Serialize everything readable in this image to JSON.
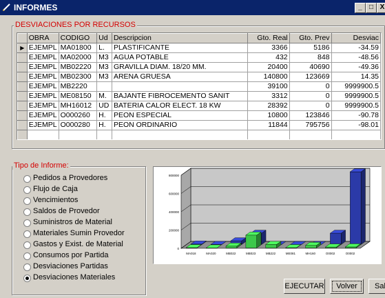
{
  "window": {
    "title": "INFORMES",
    "controls": [
      "_",
      "□",
      "X"
    ]
  },
  "grid_section": {
    "legend": "DESVIACIONES POR RECURSOS",
    "columns": [
      "OBRA",
      "CODIGO",
      "Ud",
      "Descripcion",
      "Gto. Real",
      "Gto. Prev",
      "Desviac"
    ],
    "rows": [
      [
        "EJEMPL",
        "MA01800",
        "L.",
        "PLASTIFICANTE",
        "3366",
        "5186",
        "-34.59"
      ],
      [
        "EJEMPL",
        "MA02000",
        "M3",
        "AGUA POTABLE",
        "432",
        "848",
        "-48.56"
      ],
      [
        "EJEMPL",
        "MB02220",
        "M3",
        "GRAVILLA DIAM. 18/20 MM.",
        "20400",
        "40690",
        "-49.36"
      ],
      [
        "EJEMPL",
        "MB02300",
        "M3",
        "ARENA GRUESA",
        "140800",
        "123669",
        "14.35"
      ],
      [
        "EJEMPL",
        "MB2220",
        "",
        "",
        "39100",
        "0",
        "9999900.5"
      ],
      [
        "EJEMPL",
        "ME08150",
        "M.",
        "BAJANTE FIBROCEMENTO SANIT",
        "3312",
        "0",
        "9999900.5"
      ],
      [
        "EJEMPL",
        "MH16012",
        "UD",
        "BATERIA CALOR ELECT. 18 KW",
        "28392",
        "0",
        "9999900.5"
      ],
      [
        "EJEMPL",
        "O000260",
        "H.",
        "PEON ESPECIAL",
        "10800",
        "123846",
        "-90.78"
      ],
      [
        "EJEMPL",
        "O000280",
        "H.",
        "PEON ORDINARIO",
        "11844",
        "795756",
        "-98.01"
      ]
    ],
    "current_row_marker": "▶"
  },
  "report_type": {
    "legend": "Tipo de Informe:",
    "options": [
      {
        "label": "Pedidos a Provedores",
        "selected": false
      },
      {
        "label": "Flujo de Caja",
        "selected": false
      },
      {
        "label": "Vencimientos",
        "selected": false
      },
      {
        "label": "Saldos de Provedor",
        "selected": false
      },
      {
        "label": "Suministros de Material",
        "selected": false
      },
      {
        "label": "Materiales Sumin Provedor",
        "selected": false
      },
      {
        "label": "Gastos y Exist. de Material",
        "selected": false
      },
      {
        "label": "Consumos por Partida",
        "selected": false
      },
      {
        "label": "Desviaciones Partidas",
        "selected": false
      },
      {
        "label": "Desviaciones Materiales",
        "selected": true
      }
    ]
  },
  "chart_data": {
    "type": "bar",
    "style": "3d",
    "categories": [
      "MA018",
      "MA020",
      "MB022",
      "MB023",
      "MB222",
      "ME081",
      "MH160",
      "O0002",
      "O0002"
    ],
    "series": [
      {
        "name": "",
        "color": "#2b3aa8",
        "values": [
          5186,
          848,
          40690,
          123669,
          0,
          0,
          0,
          123846,
          795756
        ]
      },
      {
        "name": "",
        "color": "#3cc84a",
        "values": [
          3366,
          432,
          20400,
          140800,
          39100,
          3312,
          28392,
          10800,
          11844
        ]
      }
    ],
    "yticks": [
      "0",
      "200000",
      "400000",
      "600000",
      "800000"
    ],
    "ylim": [
      0,
      800000
    ],
    "grid": true
  },
  "buttons": {
    "execute": "EJECUTAR",
    "back": "Volver",
    "exit": "Salir"
  }
}
